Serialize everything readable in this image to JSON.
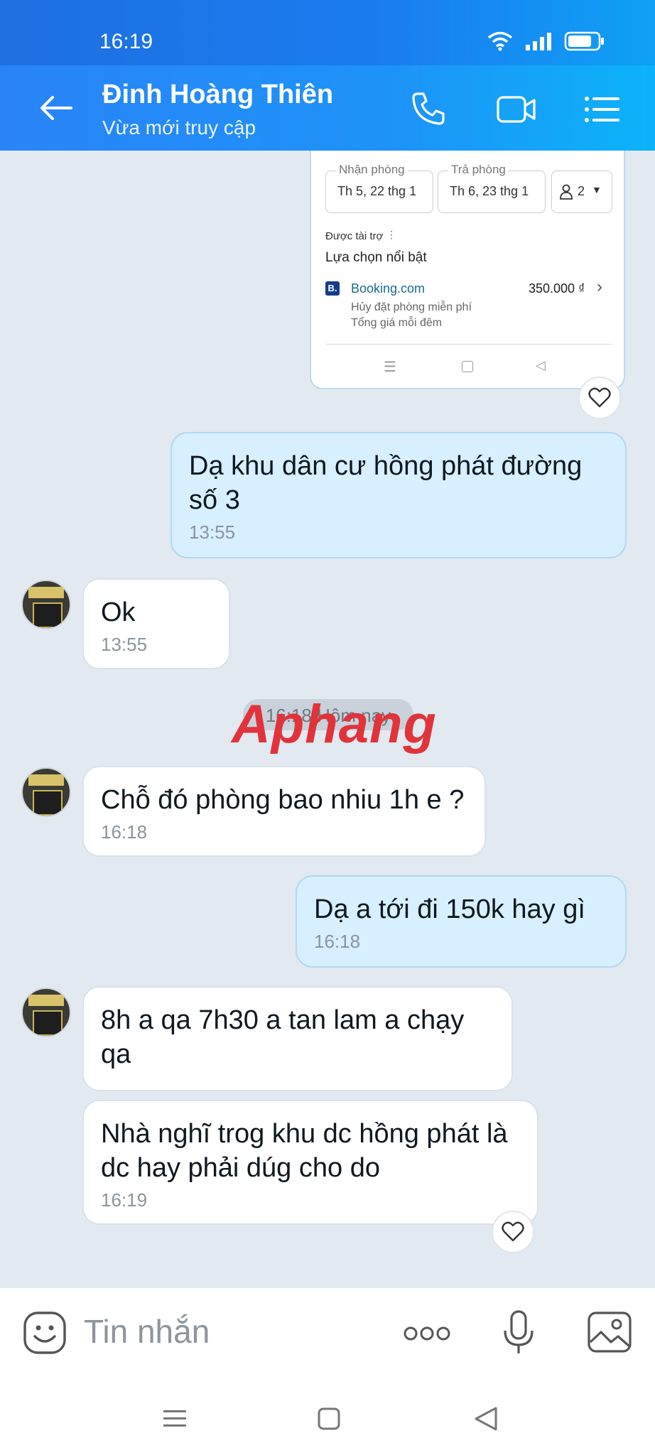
{
  "status_bar": {
    "time": "16:19"
  },
  "header": {
    "name": "Đinh Hoàng Thiên",
    "status": "Vừa mới truy cập"
  },
  "card": {
    "checkin_label": "Nhận phòng",
    "checkin_value": "Th 5, 22 thg 1",
    "checkout_label": "Trả phòng",
    "checkout_value": "Th 6, 23 thg 1",
    "guests": "2",
    "sponsored": "Được tài trợ",
    "featured": "Lựa chọn nổi bật",
    "provider_logo": "B.",
    "provider": "Booking.com",
    "price": "350.000 ₫",
    "line1": "Hủy đặt phòng miễn phí",
    "line2": "Tổng giá mỗi đêm"
  },
  "messages": [
    {
      "text": "Dạ khu dân cư hồng phát đường số 3",
      "time": "13:55"
    },
    {
      "text": "Ok",
      "time": "13:55"
    },
    {
      "text": "Chỗ đó phòng bao nhiu 1h e ?",
      "time": "16:18"
    },
    {
      "text": "Dạ a tới đi 150k hay gì",
      "time": "16:18"
    },
    {
      "text": "8h a qa 7h30 a tan lam a chạy qa"
    },
    {
      "text": "Nhà nghĩ trog khu dc hồng phát là dc hay phải dúg cho do",
      "time": "16:19"
    }
  ],
  "divider": "16:18 Hôm nay",
  "watermark": "Aphang",
  "composer": {
    "placeholder": "Tin nhắn"
  },
  "colors": {
    "header": "#1d8af6",
    "mine_bubble": "#d8efff",
    "theirs_bubble": "#ffffff",
    "background": "#e2e9f1"
  },
  "icons": [
    "back-arrow-icon",
    "phone-icon",
    "video-icon",
    "menu-icon",
    "heart-icon",
    "emoji-icon",
    "more-icon",
    "mic-icon",
    "image-icon"
  ]
}
